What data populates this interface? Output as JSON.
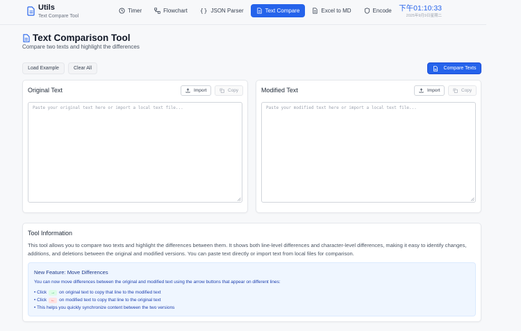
{
  "header": {
    "app_title": "Utils",
    "app_subtitle": "Text Compare Tool",
    "nav": [
      {
        "label": "Timer",
        "icon": "clock-icon",
        "active": false
      },
      {
        "label": "Flowchart",
        "icon": "flowchart-icon",
        "active": false
      },
      {
        "label": "JSON Parser",
        "icon": "braces-icon",
        "active": false
      },
      {
        "label": "Text Compare",
        "icon": "document-icon",
        "active": true
      },
      {
        "label": "Excel to MD",
        "icon": "file-icon",
        "active": false
      },
      {
        "label": "Encode",
        "icon": "shield-icon",
        "active": false
      }
    ],
    "time": "下午01:10:33",
    "date": "2025年9月9日星期二"
  },
  "page": {
    "title": "Text Comparison Tool",
    "subtitle": "Compare two texts and highlight the differences"
  },
  "toolbar": {
    "load_example": "Load Example",
    "clear_all": "Clear All",
    "compare": "Compare Texts"
  },
  "original": {
    "title": "Original Text",
    "import": "Import",
    "copy": "Copy",
    "placeholder": "Paste your original text here or import a local text file..."
  },
  "modified": {
    "title": "Modified Text",
    "import": "Import",
    "copy": "Copy",
    "placeholder": "Paste your modified text here or import a local text file..."
  },
  "info": {
    "title": "Tool Information",
    "text": "This tool allows you to compare two texts and highlight the differences between them. It shows both line-level differences and character-level differences, making it easy to identify changes, additions, and deletions between the original and modified versions. You can paste text directly or import text from local files for comparison.",
    "feature_title": "New Feature: Move Differences",
    "feature_desc": "You can now move differences between the original and modified text using the arrow buttons that appear on different lines:",
    "items": [
      {
        "prefix": "• Click",
        "chip": "→",
        "suffix": "on original text to copy that line to the modified text"
      },
      {
        "prefix": "• Click",
        "chip": "←",
        "suffix": "on modified text to copy that line to the original text"
      },
      {
        "prefix": "• This helps you quickly synchronize content between the two versions"
      }
    ]
  },
  "colors": {
    "accent": "#2563eb",
    "background": "#f7f8fa",
    "feature_bg": "#eff6ff"
  }
}
